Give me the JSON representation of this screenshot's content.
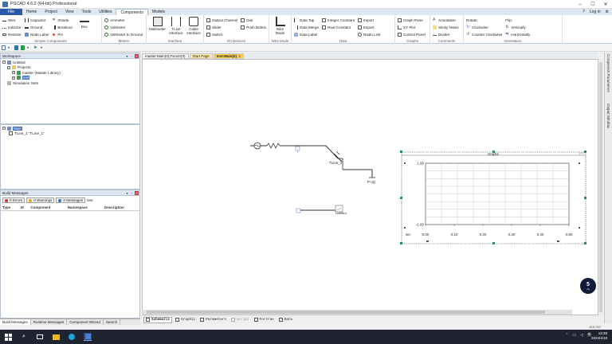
{
  "window": {
    "title": "PSCAD 4.6.2 (64-bit) Professional"
  },
  "menu": {
    "file": "File",
    "tabs": [
      "Home",
      "Project",
      "View",
      "Tools",
      "Utilities",
      "Components",
      "Models"
    ],
    "active_tab": "Components",
    "login": "Log in"
  },
  "ribbon": {
    "simple_components": {
      "label": "Simple Components",
      "col1": [
        "Wire",
        "Inductor",
        "Resistor"
      ],
      "col2": [
        "Capacitor",
        "Ground",
        "Node Label"
      ],
      "col3": [
        "XNode",
        "Breakout",
        "Pin"
      ],
      "bus": "Bus"
    },
    "meters": {
      "label": "Meters",
      "items": [
        "Ammeter",
        "Voltmeter",
        "Voltmeter to Ground"
      ]
    },
    "interface": {
      "label": "Interface",
      "multimeter": "Multimeter",
      "tline": "TLine Interface",
      "cable": "Cable Interface"
    },
    "io_devices": {
      "label": "I/O Devices",
      "col1": [
        "Output Channel",
        "Slider",
        "Switch"
      ],
      "col2": [
        "Dial",
        "Push Button"
      ]
    },
    "wire_mode": {
      "label": "Wire Mode",
      "button": "Wire Mode"
    },
    "data": {
      "label": "Data",
      "col1": [
        "Data Tap",
        "Data Merge",
        "Data Label"
      ],
      "col2": [
        "Integer Constant",
        "Real Constant"
      ],
      "col3": [
        "Import",
        "Export",
        "Radio Link"
      ]
    },
    "graphs": {
      "label": "Graphs",
      "items": [
        "Graph Pane",
        "XY Plot",
        "Control Panel"
      ]
    },
    "comments": {
      "label": "Comments",
      "items": [
        "Annotation",
        "Sticky Notes",
        "Divider"
      ]
    },
    "orientation": {
      "label": "Orientation",
      "rotate_label": "Rotate:",
      "rotate": [
        "Clockwise",
        "Counter Clockwise"
      ],
      "flip_label": "Flip:",
      "flip": [
        "Vertically",
        "Horizontally"
      ]
    }
  },
  "workspace": {
    "title": "Workspace",
    "tree": [
      "Untitled",
      "Projects",
      "master (Master Library)",
      "test",
      "Simulation Sets"
    ]
  },
  "hierarchy": {
    "title": "Main",
    "child": "TLine_1 \"TLine_1\""
  },
  "build_messages": {
    "title": "Build Messages",
    "errors": "0 Errors",
    "warnings": "0 Warnings",
    "messages": "0 Messages",
    "project": "test",
    "columns": [
      "Type",
      "Id",
      "Component",
      "Namespace",
      "Description"
    ]
  },
  "bottom_tabs": [
    "Build Messages",
    "Runtime Messages",
    "Component Wizard",
    "Search"
  ],
  "doc_tabs": [
    "master:Main(0):Fscosr(0)",
    "Start Page",
    "test:Main(0)"
  ],
  "canvas": {
    "tline_label": "TLine_1",
    "tap_label": "P+jQ",
    "untitled_label": "Untitled",
    "graphs_title": "Graphs"
  },
  "chart_data": {
    "type": "line",
    "title": "Graphs",
    "xlabel": "sec",
    "ylabel": "",
    "x_ticks": [
      "0.00",
      "0.10",
      "0.20",
      "0.30",
      "0.40",
      "0.50"
    ],
    "y_ticks": [
      "1.00",
      "-1.00"
    ],
    "xlim": [
      0,
      0.5
    ],
    "ylim": [
      -1,
      1
    ],
    "grid": true,
    "series": []
  },
  "view_tabs": [
    "Schematic",
    "Graphic",
    "Parameters",
    "Script",
    "Fortran",
    "Data"
  ],
  "right_strip": [
    "Component Parameters",
    "Output Window"
  ],
  "status": {
    "coords": "815,297"
  },
  "taskbar": {
    "time": "14:28",
    "date": "2022/4/18",
    "lang": "英"
  },
  "badge": {
    "value": "5",
    "unit": "ms"
  },
  "colors": {
    "accent": "#2a59a8",
    "active_tab": "#fbd24e",
    "grid": "#b8b8b8",
    "taskbar": "#1f2430"
  }
}
